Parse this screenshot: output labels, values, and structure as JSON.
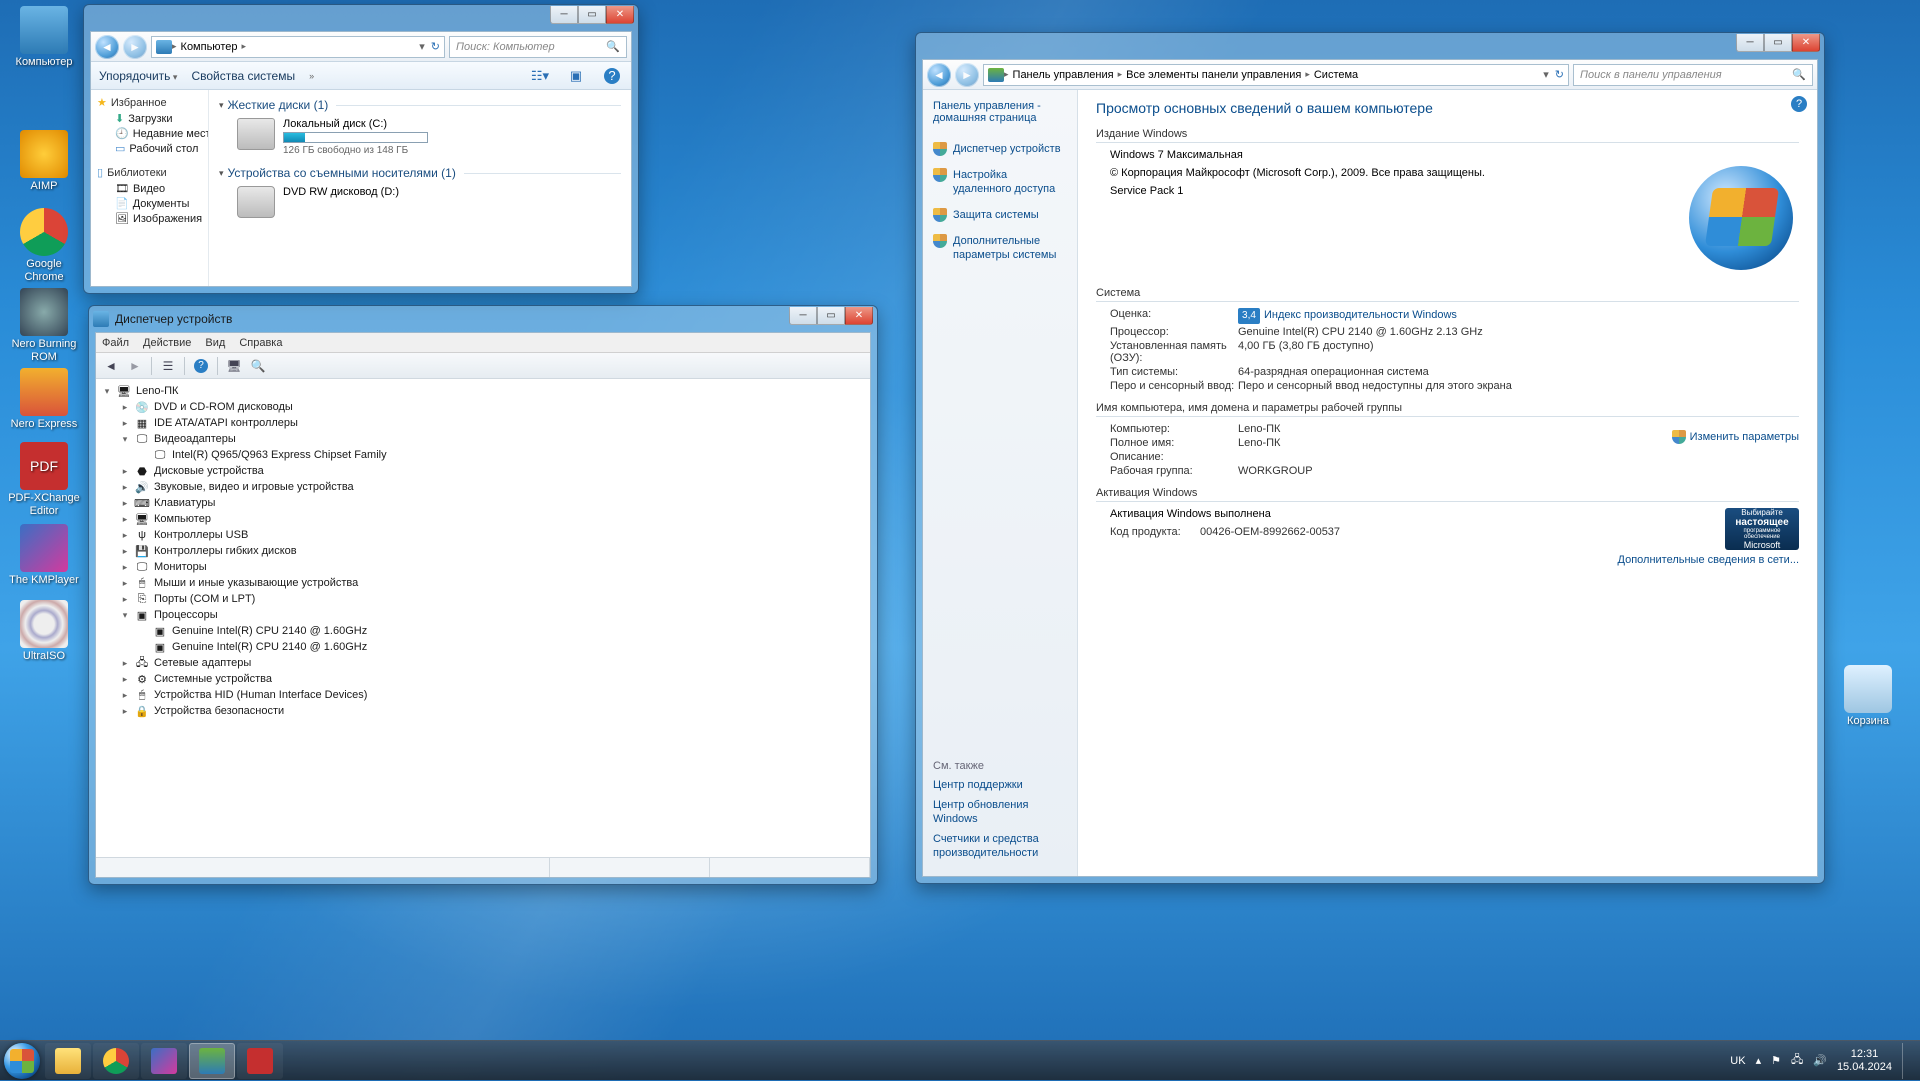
{
  "desktop_icons": [
    {
      "label": "Компьютер",
      "kind": "monitor"
    },
    {
      "label": "AIMP",
      "kind": "aimp"
    },
    {
      "label": "Google Chrome",
      "kind": "chrome"
    },
    {
      "label": "Nero Burning ROM",
      "kind": "nero"
    },
    {
      "label": "Nero Express",
      "kind": "neroexp"
    },
    {
      "label": "PDF-XChange Editor",
      "kind": "pdf"
    },
    {
      "label": "The KMPlayer",
      "kind": "km"
    },
    {
      "label": "UltraISO",
      "kind": "ultraiso"
    }
  ],
  "recycle": {
    "label": "Корзина"
  },
  "explorer": {
    "title": "",
    "breadcrumb": {
      "root": "Компьютер"
    },
    "search_placeholder": "Поиск: Компьютер",
    "toolbar": {
      "organize": "Упорядочить",
      "props": "Свойства системы"
    },
    "nav": {
      "fav_header": "Избранное",
      "fav_items": [
        "Загрузки",
        "Недавние места",
        "Рабочий стол"
      ],
      "lib_header": "Библиотеки",
      "lib_items": [
        "Видео",
        "Документы",
        "Изображения"
      ]
    },
    "cats": {
      "hdd": "Жесткие диски (1)",
      "removable": "Устройства со съемными носителями (1)"
    },
    "c_drive": {
      "name": "Локальный диск (C:)",
      "free": "126 ГБ свободно из 148 ГБ",
      "pct": 15
    },
    "dvd": {
      "name": "DVD RW дисковод (D:)"
    }
  },
  "devmgr": {
    "title": "Диспетчер устройств",
    "menu": [
      "Файл",
      "Действие",
      "Вид",
      "Справка"
    ],
    "root": "Leno-ПК",
    "nodes": [
      {
        "l": "DVD и CD-ROM дисководы",
        "i": "cd",
        "d": 1
      },
      {
        "l": "IDE ATA/ATAPI контроллеры",
        "i": "chip",
        "d": 1
      },
      {
        "l": "Видеоадаптеры",
        "i": "display",
        "d": 1,
        "open": true
      },
      {
        "l": "Intel(R)  Q965/Q963 Express Chipset Family",
        "i": "display",
        "d": 2
      },
      {
        "l": "Дисковые устройства",
        "i": "disk",
        "d": 1
      },
      {
        "l": "Звуковые, видео и игровые устройства",
        "i": "sound",
        "d": 1
      },
      {
        "l": "Клавиатуры",
        "i": "kb",
        "d": 1
      },
      {
        "l": "Компьютер",
        "i": "pc",
        "d": 1
      },
      {
        "l": "Контроллеры USB",
        "i": "usb",
        "d": 1
      },
      {
        "l": "Контроллеры гибких дисков",
        "i": "floppy",
        "d": 1
      },
      {
        "l": "Мониторы",
        "i": "mon",
        "d": 1
      },
      {
        "l": "Мыши и иные указывающие устройства",
        "i": "mouse",
        "d": 1
      },
      {
        "l": "Порты (COM и LPT)",
        "i": "port",
        "d": 1
      },
      {
        "l": "Процессоры",
        "i": "cpu",
        "d": 1,
        "open": true
      },
      {
        "l": "Genuine Intel(R) CPU           2140  @ 1.60GHz",
        "i": "cpu",
        "d": 2
      },
      {
        "l": "Genuine Intel(R) CPU           2140  @ 1.60GHz",
        "i": "cpu",
        "d": 2
      },
      {
        "l": "Сетевые адаптеры",
        "i": "net",
        "d": 1
      },
      {
        "l": "Системные устройства",
        "i": "sys",
        "d": 1
      },
      {
        "l": "Устройства HID (Human Interface Devices)",
        "i": "hid",
        "d": 1
      },
      {
        "l": "Устройства безопасности",
        "i": "sec",
        "d": 1
      }
    ]
  },
  "sys": {
    "breadcrumb": [
      "Панель управления",
      "Все элементы панели управления",
      "Система"
    ],
    "search_placeholder": "Поиск в панели управления",
    "side": {
      "home": "Панель управления - домашняя страница",
      "links": [
        "Диспетчер устройств",
        "Настройка удаленного доступа",
        "Защита системы",
        "Дополнительные параметры системы"
      ],
      "see_also_hdr": "См. также",
      "see_also": [
        "Центр поддержки",
        "Центр обновления Windows",
        "Счетчики и средства производительности"
      ]
    },
    "main": {
      "title": "Просмотр основных сведений о вашем компьютере",
      "edition_hdr": "Издание Windows",
      "edition": "Windows 7 Максимальная",
      "copyright": "© Корпорация Майкрософт (Microsoft Corp.), 2009. Все права защищены.",
      "sp": "Service Pack 1",
      "system_hdr": "Система",
      "score_k": "Оценка:",
      "score_v": "3,4",
      "score_link": "Индекс производительности Windows",
      "cpu_k": "Процессор:",
      "cpu_v": "Genuine Intel(R) CPU           2140  @ 1.60GHz   2.13 GHz",
      "ram_k": "Установленная память (ОЗУ):",
      "ram_v": "4,00 ГБ (3,80 ГБ доступно)",
      "type_k": "Тип системы:",
      "type_v": "64-разрядная операционная система",
      "pen_k": "Перо и сенсорный ввод:",
      "pen_v": "Перо и сенсорный ввод недоступны для этого экрана",
      "name_hdr": "Имя компьютера, имя домена и параметры рабочей группы",
      "comp_k": "Компьютер:",
      "comp_v": "Leno-ПК",
      "full_k": "Полное имя:",
      "full_v": "Leno-ПК",
      "desc_k": "Описание:",
      "desc_v": "",
      "wg_k": "Рабочая группа:",
      "wg_v": "WORKGROUP",
      "change": "Изменить параметры",
      "act_hdr": "Активация Windows",
      "act_line": "Активация Windows выполнена",
      "pid_k": "Код продукта:",
      "pid_v": "00426-OEM-8992662-00537",
      "more": "Дополнительные сведения в сети...",
      "genuine1": "Выбирайте",
      "genuine2": "настоящее",
      "genuine3": "программное обеспечение",
      "genuine4": "Microsoft"
    }
  },
  "taskbar": {
    "lang": "UK",
    "time": "12:31",
    "date": "15.04.2024"
  }
}
